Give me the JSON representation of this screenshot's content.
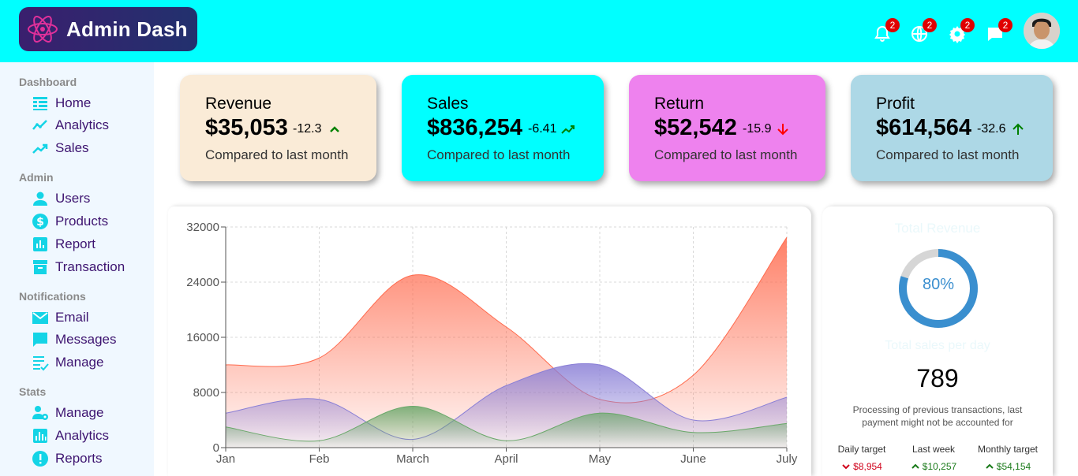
{
  "app": {
    "title": "Admin Dash"
  },
  "topbar": {
    "notifications_badge": "2",
    "language_badge": "2",
    "settings_badge": "2",
    "messages_badge": "2"
  },
  "sidebar": {
    "sections": [
      {
        "title": "Dashboard",
        "items": [
          {
            "label": "Home",
            "icon": "home-table-icon"
          },
          {
            "label": "Analytics",
            "icon": "line-trend-icon"
          },
          {
            "label": "Sales",
            "icon": "trending-up-icon"
          }
        ]
      },
      {
        "title": "Admin",
        "items": [
          {
            "label": "Users",
            "icon": "person-icon"
          },
          {
            "label": "Products",
            "icon": "dollar-icon"
          },
          {
            "label": "Report",
            "icon": "bar-report-icon"
          },
          {
            "label": "Transaction",
            "icon": "archive-icon"
          }
        ]
      },
      {
        "title": "Notifications",
        "items": [
          {
            "label": "Email",
            "icon": "mail-icon"
          },
          {
            "label": "Messages",
            "icon": "chat-icon"
          },
          {
            "label": "Manage",
            "icon": "list-check-icon"
          }
        ]
      },
      {
        "title": "Stats",
        "items": [
          {
            "label": "Manage",
            "icon": "users-gear-icon"
          },
          {
            "label": "Analytics",
            "icon": "bar-chart-icon"
          },
          {
            "label": "Reports",
            "icon": "alert-circle-icon"
          }
        ]
      }
    ]
  },
  "cards": [
    {
      "title": "Revenue",
      "value": "$35,053",
      "change": "-12.3",
      "trend": "up-chevron",
      "subtitle": "Compared to last month",
      "color": "#faebd7",
      "arrow_color": "#008000"
    },
    {
      "title": "Sales",
      "value": "$836,254",
      "change": "-6.41",
      "trend": "trending-up",
      "subtitle": "Compared to last month",
      "color": "#00ffff",
      "arrow_color": "#008000"
    },
    {
      "title": "Return",
      "value": "$52,542",
      "change": "-15.9",
      "trend": "down-arrow",
      "subtitle": "Compared to last month",
      "color": "#ee82ee",
      "arrow_color": "#ff0000"
    },
    {
      "title": "Profit",
      "value": "$614,564",
      "change": "-32.6",
      "trend": "up-arrow",
      "subtitle": "Compared to last month",
      "color": "#add8e6",
      "arrow_color": "#008000"
    }
  ],
  "chart_data": {
    "type": "area",
    "categories": [
      "Jan",
      "Feb",
      "March",
      "April",
      "May",
      "June",
      "July"
    ],
    "ylim": [
      0,
      32000
    ],
    "yticks": [
      "0",
      "8000",
      "16000",
      "24000",
      "32000"
    ],
    "grid": true,
    "series": [
      {
        "values": [
          12000,
          13000,
          25000,
          17500,
          7000,
          10500,
          30500
        ],
        "color": "#ff6a4d"
      },
      {
        "values": [
          5000,
          7000,
          1200,
          9000,
          12000,
          4000,
          7300
        ],
        "color": "#8a7fd6"
      },
      {
        "values": [
          3000,
          1000,
          6000,
          1000,
          5000,
          2200,
          3500
        ],
        "color": "#6aa86a"
      }
    ]
  },
  "right_panel": {
    "title": "Total Revenue",
    "donut_percent": 80,
    "donut_label": "80%",
    "subtitle": "Total sales per day",
    "daily_sales": "789",
    "note": "Processing of previous transactions, last payment might not be accounted for",
    "targets": [
      {
        "label": "Daily target",
        "value": "$8,954",
        "direction": "down",
        "color": "#d0021b"
      },
      {
        "label": "Last week",
        "value": "$10,257",
        "direction": "up",
        "color": "#1a7a1a"
      },
      {
        "label": "Monthly target",
        "value": "$54,154",
        "direction": "up",
        "color": "#1a7a1a"
      }
    ]
  }
}
